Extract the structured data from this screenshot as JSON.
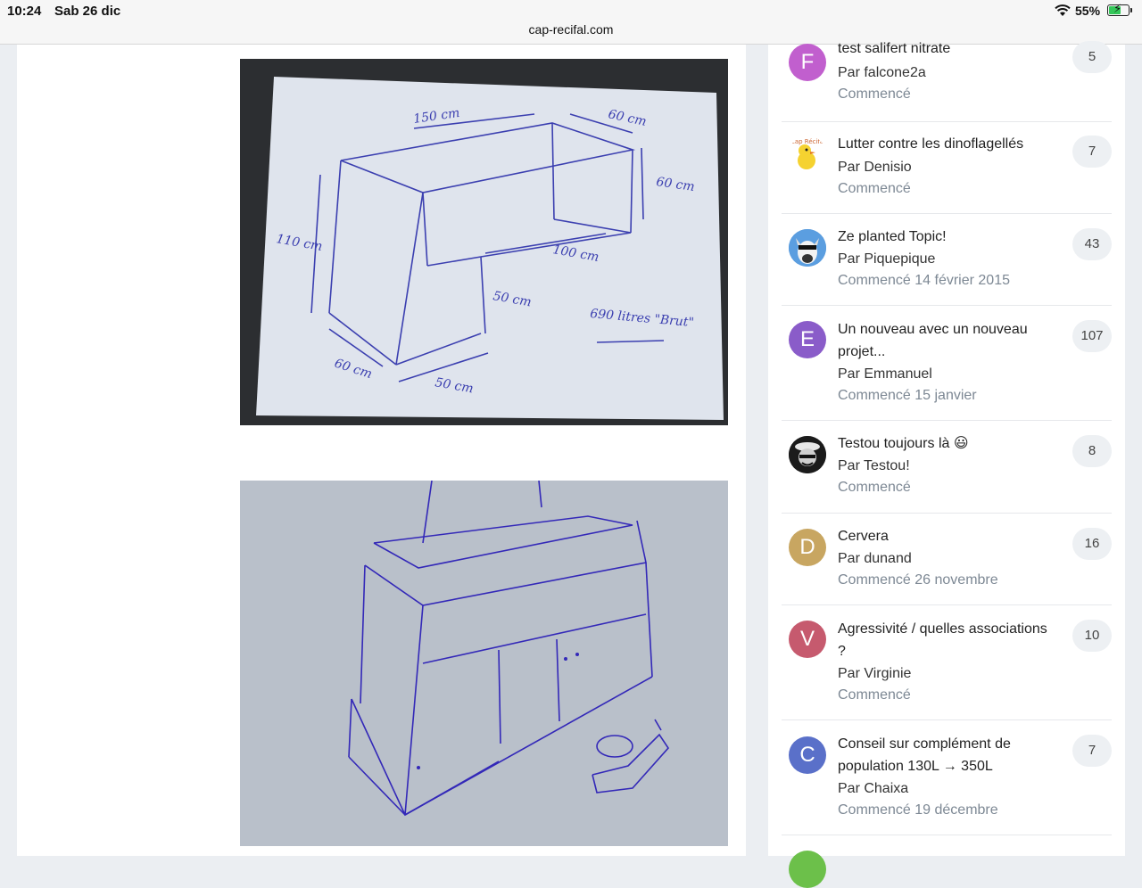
{
  "status": {
    "time": "10:24",
    "date": "Sab 26 dic",
    "battery": "55%",
    "battery_level": 0.55
  },
  "url": "cap-recifal.com",
  "sketch1": {
    "labels": [
      "150 cm",
      "60 cm",
      "60 cm",
      "110 cm",
      "100 cm",
      "50 cm",
      "60 cm",
      "50 cm",
      "690 litres \"Brut\""
    ]
  },
  "topics": [
    {
      "title": "test salifert nitrate",
      "author": "Par falcone2a",
      "started": "Commencé",
      "count": "5",
      "avatar_letter": "F",
      "avatar_color": "#c15fce"
    },
    {
      "title": "Lutter contre les dinoflagellés",
      "author": "Par Denisio",
      "started": "Commencé",
      "count": "7",
      "avatar_text": "cap Récifal",
      "avatar_color": "#ffffff"
    },
    {
      "title": "Ze planted Topic!",
      "author": "Par Piquepique",
      "started": "Commencé 14 février 2015",
      "count": "43",
      "avatar_color": "#3a7dc9"
    },
    {
      "title": "Un nouveau avec un nouveau projet...",
      "author": "Par Emmanuel",
      "started": "Commencé 15 janvier",
      "count": "107",
      "avatar_letter": "E",
      "avatar_color": "#8a5cc9"
    },
    {
      "title": "Testou toujours là 😃",
      "author": "Par Testou!",
      "started": "Commencé",
      "count": "8",
      "avatar_color": "#222222"
    },
    {
      "title": "Cervera",
      "author": "Par dunand",
      "started": "Commencé 26 novembre",
      "count": "16",
      "avatar_letter": "D",
      "avatar_color": "#c8a661"
    },
    {
      "title": "Agressivité / quelles associations ?",
      "author": "Par Virginie",
      "started": "Commencé",
      "count": "10",
      "avatar_letter": "V",
      "avatar_color": "#c65a6e"
    },
    {
      "title": "Conseil sur complément de population 130L → 350L",
      "author": "Par Chaixa",
      "started": "Commencé 19 décembre",
      "count": "7",
      "avatar_letter": "C",
      "avatar_color": "#5a70c9"
    }
  ]
}
